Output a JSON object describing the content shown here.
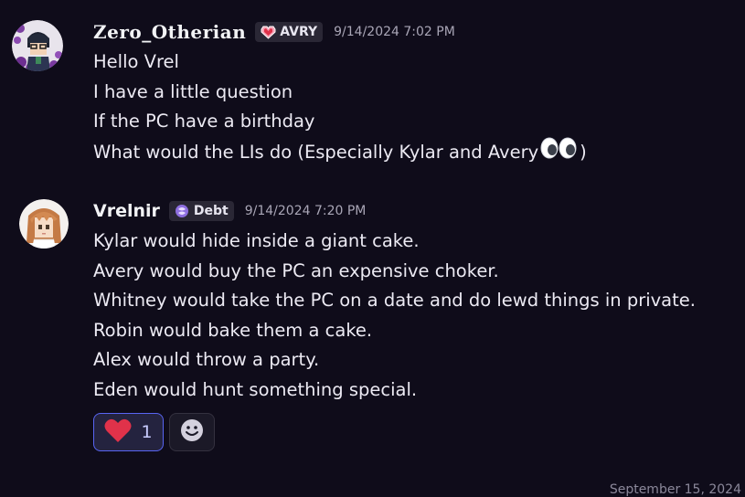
{
  "messages": [
    {
      "author": "Zero_Otherian",
      "tag": "AVRY",
      "tag_icon": "pixel-heart-icon",
      "timestamp": "9/14/2024 7:02 PM",
      "lines": [
        "Hello Vrel",
        "I have a little question",
        "If the PC have a birthday",
        "What would the LIs do (Especially Kylar and Avery",
        ")"
      ],
      "inline_emoji": "eyes-emoji"
    },
    {
      "author": "Vrelnir",
      "tag": "Debt",
      "tag_icon": "swirl-badge-icon",
      "timestamp": "9/14/2024 7:20 PM",
      "lines": [
        "Kylar would hide inside a giant cake.",
        "Avery would buy the PC an expensive choker.",
        "Whitney would take the PC on a date and do lewd things in private.",
        "Robin would bake them a cake.",
        "Alex would throw a party.",
        "Eden would hunt something special."
      ],
      "reactions": [
        {
          "emoji": "heart-emoji",
          "count": "1"
        }
      ],
      "add_reaction_icon": "smiley-icon"
    }
  ],
  "divider": {
    "date": "September 15, 2024"
  },
  "colors": {
    "background": "#0f0c1a",
    "accent": "#5865f2",
    "heart": "#e0324a",
    "badge_bg": "#2a2735"
  }
}
